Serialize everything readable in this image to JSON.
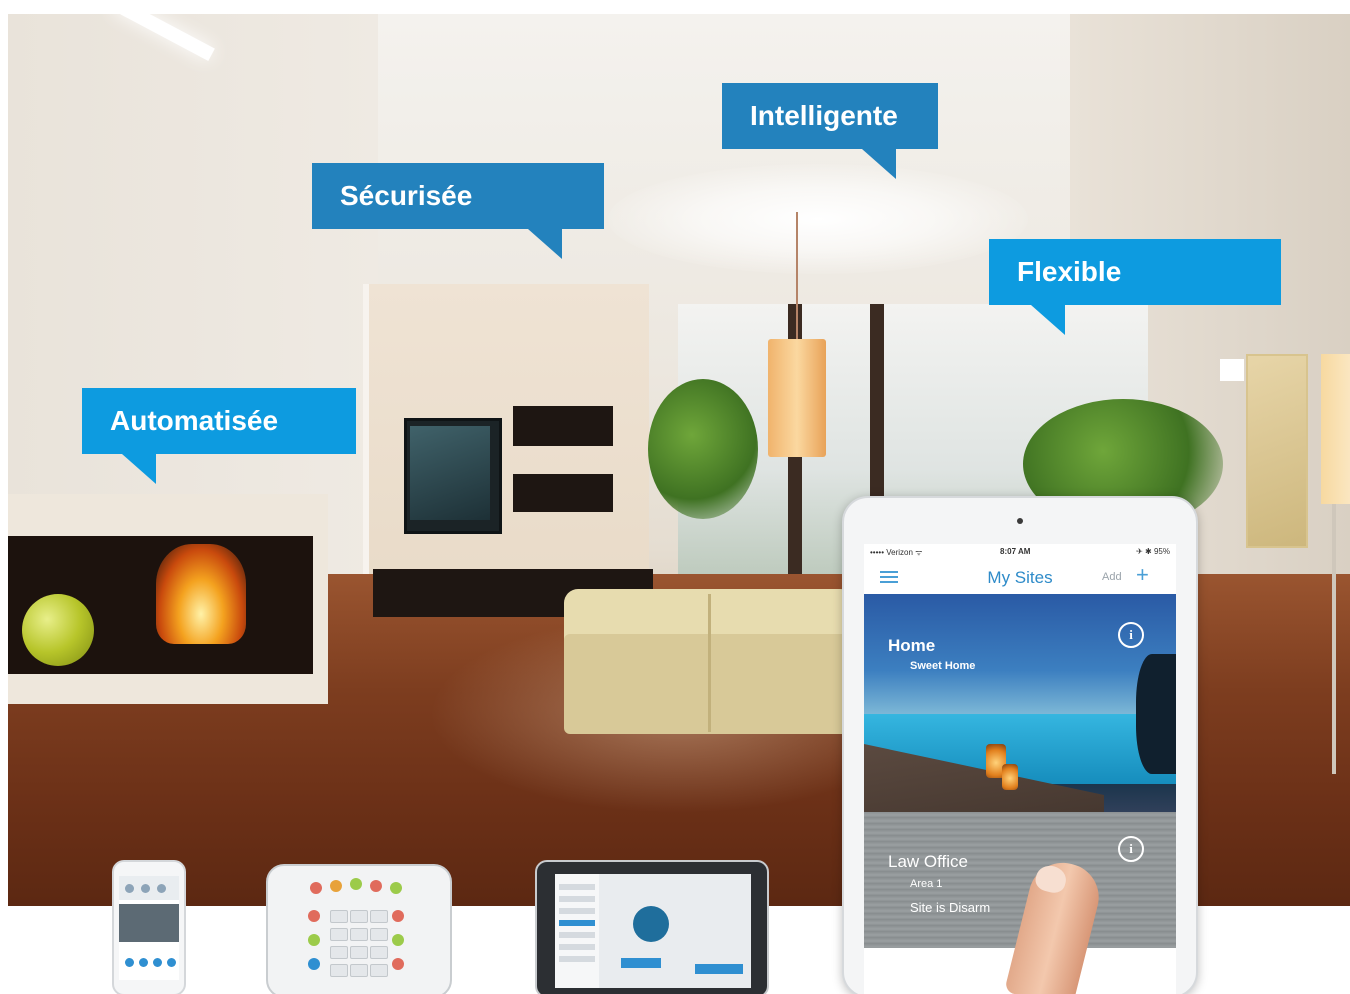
{
  "callouts": {
    "intelligente": "Intelligente",
    "securisee": "Sécurisée",
    "flexible": "Flexible",
    "automatisee": "Automatisée"
  },
  "tablet_app": {
    "status": {
      "carrier": "••••• Verizon ᯤ",
      "time": "8:07 AM",
      "battery": "✈ ✱ 95%"
    },
    "title": "My Sites",
    "add_label": "Add",
    "add_symbol": "+",
    "sites": [
      {
        "name": "Home",
        "subtitle": "Sweet Home",
        "info": "i"
      },
      {
        "name": "Law Office",
        "subtitle": "Area 1",
        "status": "Site is Disarm",
        "info": "i"
      }
    ]
  },
  "colors": {
    "callout_blue": "#2382bd",
    "callout_bright_blue": "#0d9be0",
    "app_accent": "#2e8bc9"
  }
}
